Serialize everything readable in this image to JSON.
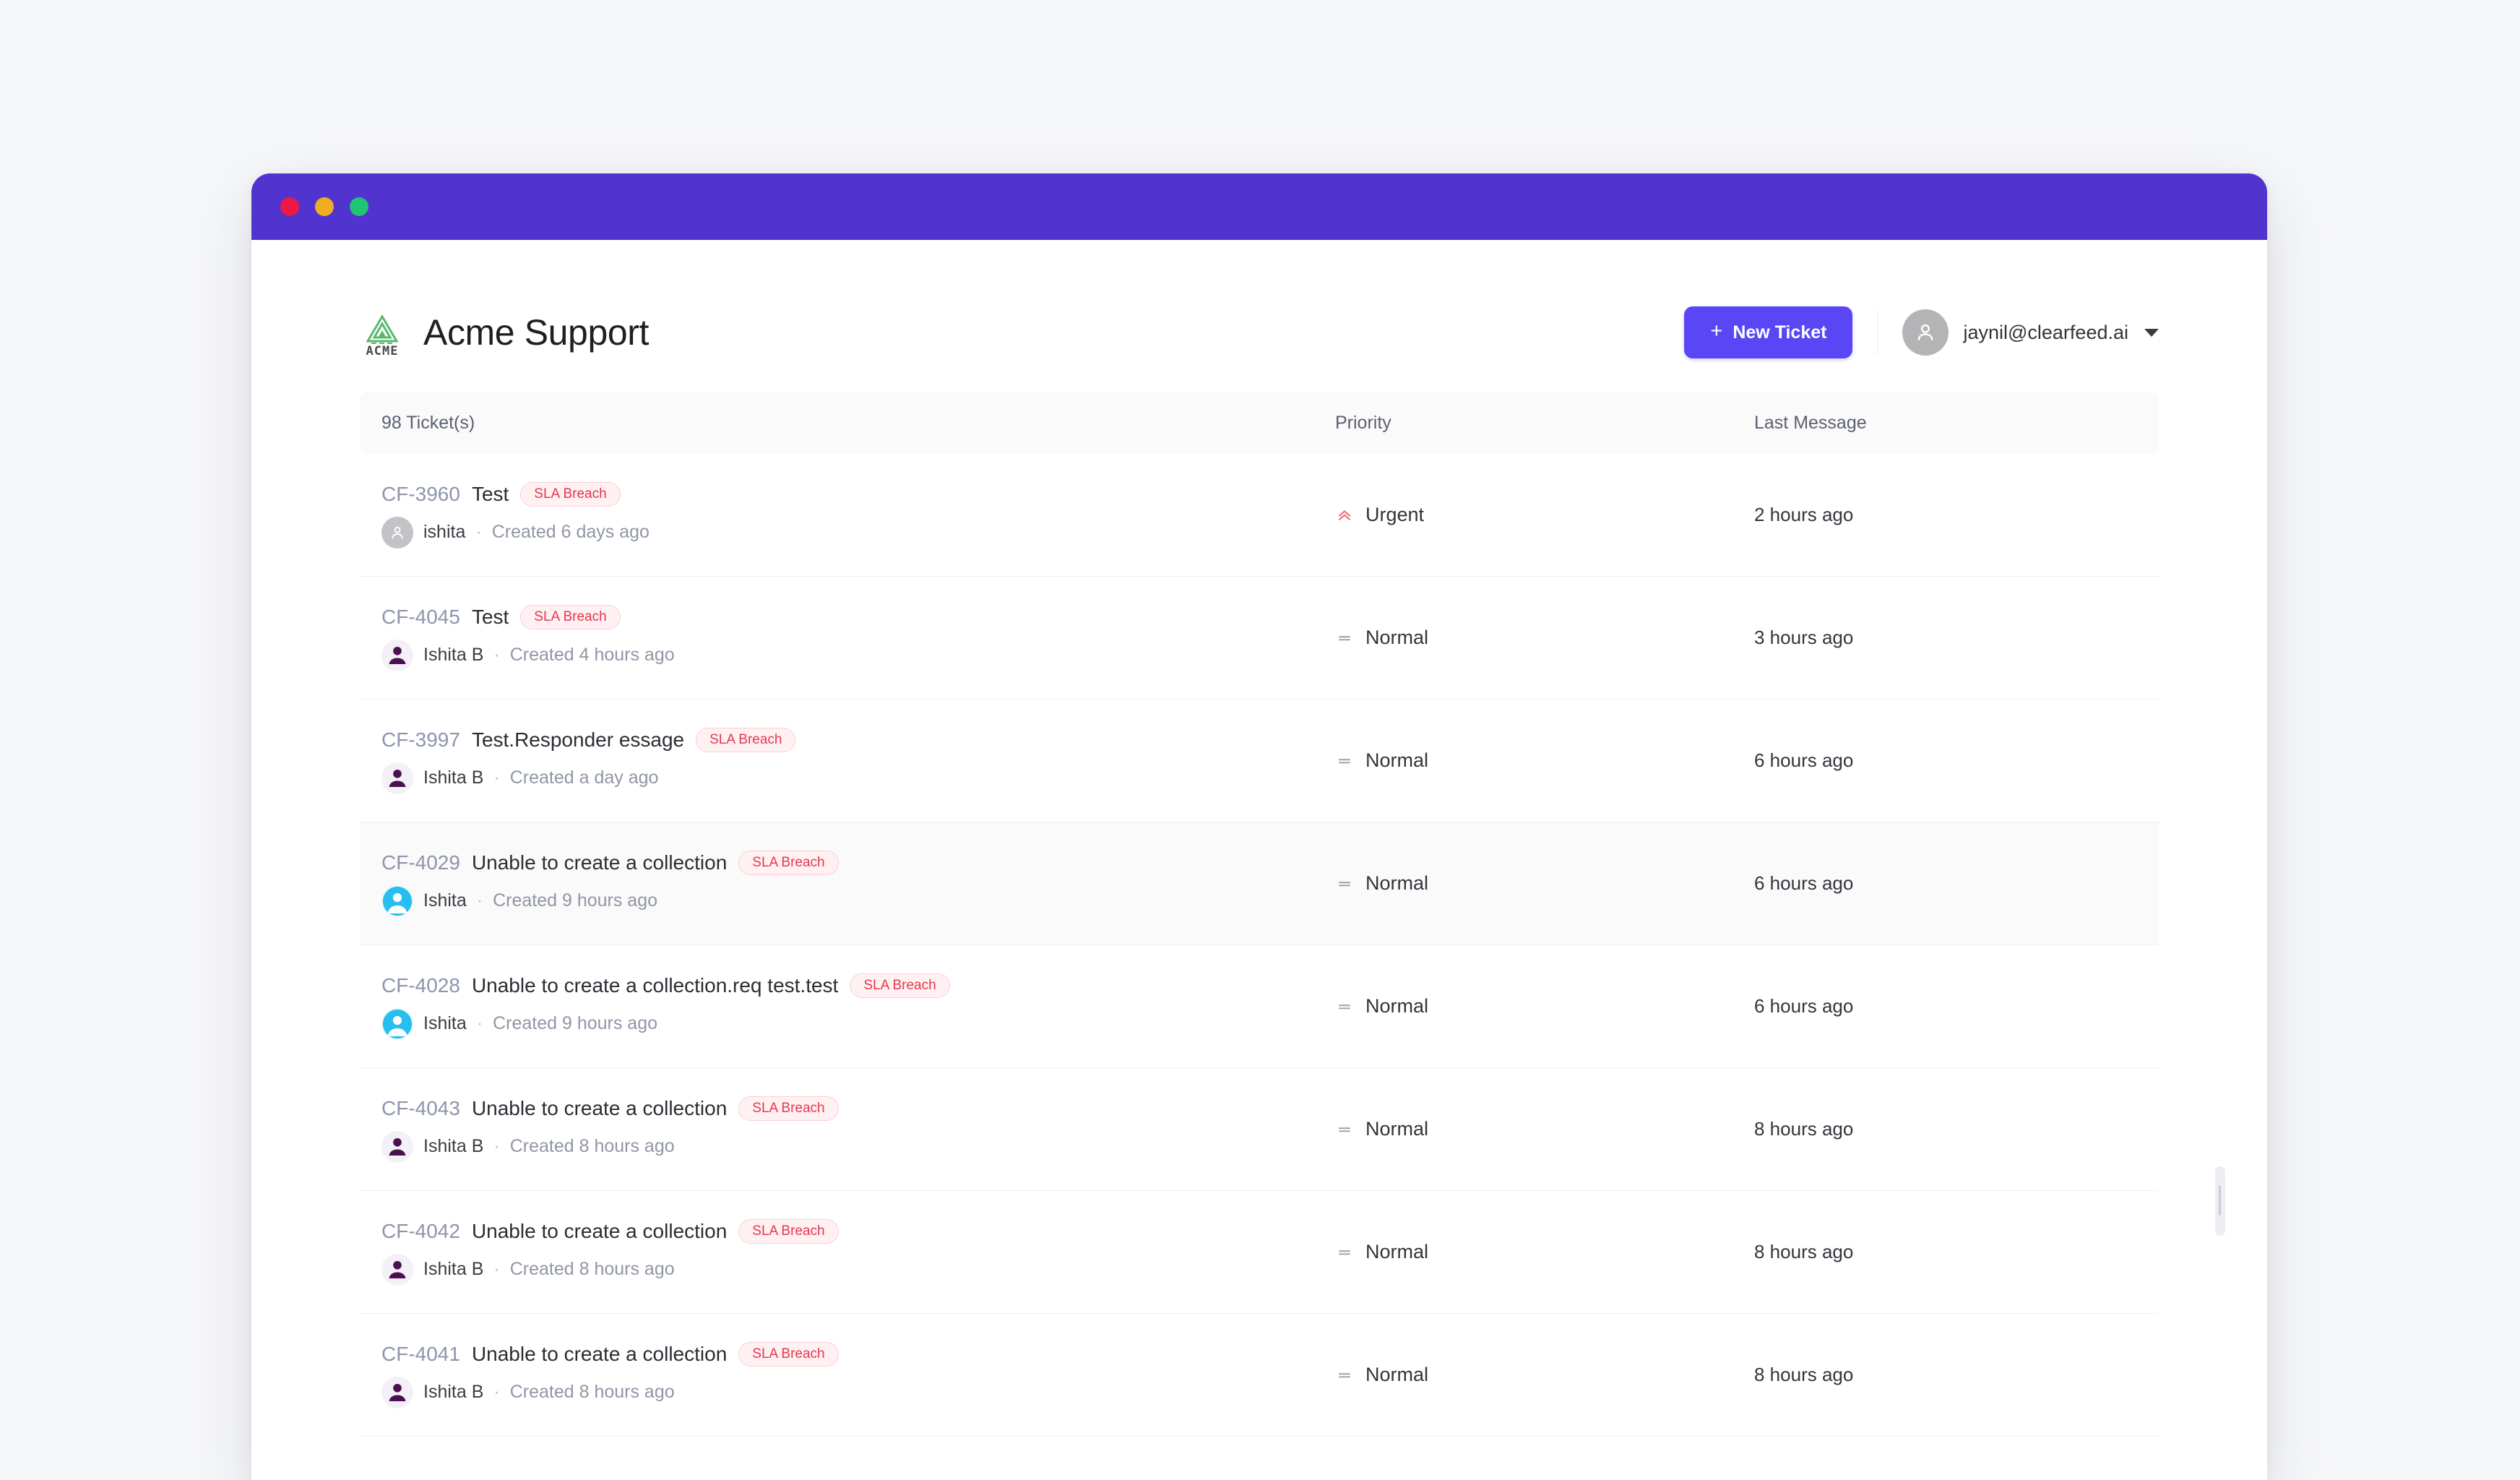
{
  "window": {
    "traffic_lights": [
      "close",
      "minimize",
      "maximize"
    ],
    "titlebar_color": "#5134cf"
  },
  "header": {
    "logo_word": "ACME",
    "title": "Acme Support",
    "new_ticket_label": "New Ticket",
    "new_ticket_plus": "+",
    "new_ticket_color": "#5b46f5",
    "user_email": "jaynil@clearfeed.ai"
  },
  "table": {
    "columns": {
      "tickets": "98 Ticket(s)",
      "priority": "Priority",
      "last_message": "Last Message"
    },
    "rows": [
      {
        "id": "CF-3960",
        "title": "Test",
        "badge": "SLA Breach",
        "author": "ishita",
        "sep": "·",
        "created": "Created 6 days ago",
        "avatar": "gray",
        "priority": "Urgent",
        "priority_icon": "double-chevron-up-icon",
        "last_message": "2 hours ago",
        "active": false
      },
      {
        "id": "CF-4045",
        "title": "Test",
        "badge": "SLA Breach",
        "author": "Ishita B",
        "sep": "·",
        "created": "Created 4 hours ago",
        "avatar": "purple",
        "priority": "Normal",
        "priority_icon": "equals-icon",
        "last_message": "3 hours ago",
        "active": false
      },
      {
        "id": "CF-3997",
        "title": "Test.Responder essage",
        "badge": "SLA Breach",
        "author": "Ishita B",
        "sep": "·",
        "created": "Created a day ago",
        "avatar": "purple",
        "priority": "Normal",
        "priority_icon": "equals-icon",
        "last_message": "6 hours ago",
        "active": false
      },
      {
        "id": "CF-4029",
        "title": "Unable to create a collection",
        "badge": "SLA Breach",
        "author": "Ishita",
        "sep": "·",
        "created": "Created 9 hours ago",
        "avatar": "cyan",
        "priority": "Normal",
        "priority_icon": "equals-icon",
        "last_message": "6 hours ago",
        "active": true
      },
      {
        "id": "CF-4028",
        "title": "Unable to create a collection.req test.test",
        "badge": "SLA Breach",
        "author": "Ishita",
        "sep": "·",
        "created": "Created 9 hours ago",
        "avatar": "cyan",
        "priority": "Normal",
        "priority_icon": "equals-icon",
        "last_message": "6 hours ago",
        "active": false
      },
      {
        "id": "CF-4043",
        "title": "Unable to create a collection",
        "badge": "SLA Breach",
        "author": "Ishita B",
        "sep": "·",
        "created": "Created 8 hours ago",
        "avatar": "purple",
        "priority": "Normal",
        "priority_icon": "equals-icon",
        "last_message": "8 hours ago",
        "active": false
      },
      {
        "id": "CF-4042",
        "title": "Unable to create a collection",
        "badge": "SLA Breach",
        "author": "Ishita B",
        "sep": "·",
        "created": "Created 8 hours ago",
        "avatar": "purple",
        "priority": "Normal",
        "priority_icon": "equals-icon",
        "last_message": "8 hours ago",
        "active": false
      },
      {
        "id": "CF-4041",
        "title": "Unable to create a collection",
        "badge": "SLA Breach",
        "author": "Ishita B",
        "sep": "·",
        "created": "Created 8 hours ago",
        "avatar": "purple",
        "priority": "Normal",
        "priority_icon": "equals-icon",
        "last_message": "8 hours ago",
        "active": false
      }
    ]
  },
  "colors": {
    "accent": "#5b46f5",
    "titlebar": "#5134cf",
    "sla_text": "#e5374f",
    "sla_bg": "#fff0f2",
    "urgent": "#f2667a",
    "logo_green": "#4caf63"
  }
}
